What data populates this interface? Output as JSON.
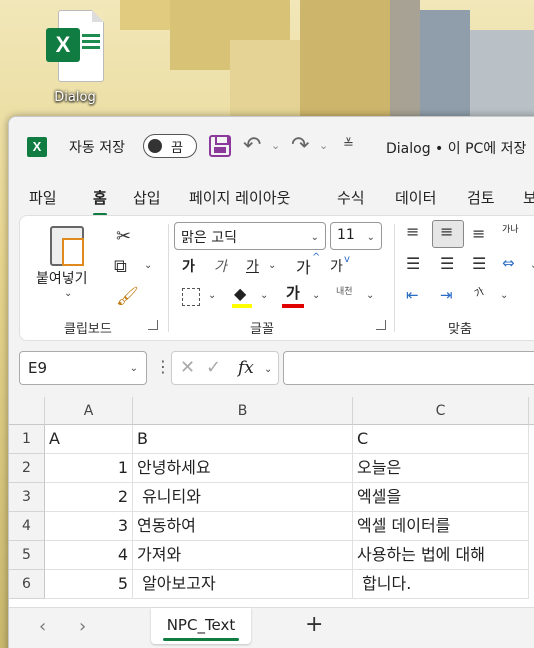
{
  "desktop": {
    "icon_label": "Dialog"
  },
  "window": {
    "autosave_label": "자동 저장",
    "autosave_state": "끔",
    "title": "Dialog • 이 PC에 저장"
  },
  "menu": [
    "파일",
    "홈",
    "삽입",
    "페이지 레이아웃",
    "수식",
    "데이터",
    "검토",
    "보"
  ],
  "ribbon": {
    "paste_label": "붙여넣기",
    "font_name": "맑은 고딕",
    "font_size": "11",
    "bold": "가",
    "italic": "가",
    "underline": "가",
    "grow_font": "가",
    "shrink_font": "가",
    "font_color_glyph": "가",
    "phonetic_label": "내천",
    "wrap_label": "가나",
    "orient_label": "가",
    "groups": {
      "clipboard": "클립보드",
      "font": "글꼴",
      "alignment": "맞춤"
    }
  },
  "formula_bar": {
    "name_box": "E9",
    "fx": "fx"
  },
  "sheet": {
    "columns": [
      "A",
      "B",
      "C"
    ],
    "rows": [
      {
        "num": "1",
        "a": "A",
        "b": "B",
        "c": "C"
      },
      {
        "num": "2",
        "a": "1",
        "b": "안녕하세요",
        "c": "오늘은"
      },
      {
        "num": "3",
        "a": "2",
        "b": " 유니티와",
        "c": "엑셀을"
      },
      {
        "num": "4",
        "a": "3",
        "b": "연동하여",
        "c": "엑셀 데이터를"
      },
      {
        "num": "5",
        "a": "4",
        "b": "가져와",
        "c": "사용하는 법에 대해"
      },
      {
        "num": "6",
        "a": "5",
        "b": " 알아보고자",
        "c": " 합니다."
      }
    ]
  },
  "tabs": {
    "sheet_name": "NPC_Text",
    "add_sheet": "+"
  },
  "colors": {
    "excel_green": "#107c41",
    "accent_purple": "#8b3a9c",
    "highlight_yellow": "#ffff00",
    "font_red": "#e00000"
  }
}
